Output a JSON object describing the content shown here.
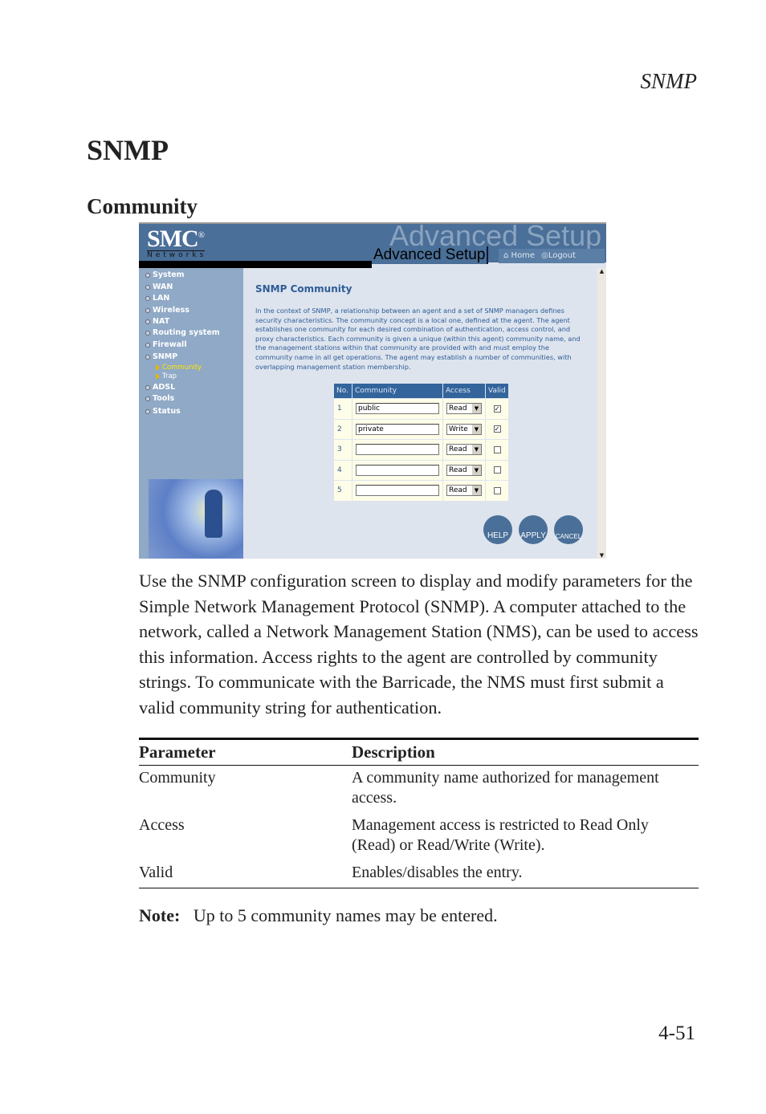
{
  "running_head": "SNMP",
  "heading": "SNMP",
  "subheading": "Community",
  "screenshot": {
    "logo": "SMC",
    "logo_sub": "Networks",
    "banner_ghost": "Advanced Setup",
    "banner": "Advanced Setup",
    "home": "Home",
    "logout": "Logout",
    "nav": [
      "System",
      "WAN",
      "LAN",
      "Wireless",
      "NAT",
      "Routing system",
      "Firewall",
      "SNMP",
      "ADSL",
      "Tools",
      "Status"
    ],
    "subnav": [
      "Community",
      "Trap"
    ],
    "title": "SNMP Community",
    "description": "In the context of SNMP, a relationship between an agent and a set of SNMP managers defines security characteristics. The community concept is a local one, defined at the agent. The agent establishes one community for each desired combination of authentication, access control, and proxy characteristics. Each community is given a unique (within this agent) community name, and the management stations within that community are provided with and must employ the community name in all get operations. The agent may establish a number of communities, with overlapping management station membership.",
    "table_headers": [
      "No.",
      "Community",
      "Access",
      "Valid"
    ],
    "rows": [
      {
        "no": "1",
        "community": "public",
        "access": "Read",
        "valid": true
      },
      {
        "no": "2",
        "community": "private",
        "access": "Write",
        "valid": true
      },
      {
        "no": "3",
        "community": "",
        "access": "Read",
        "valid": false
      },
      {
        "no": "4",
        "community": "",
        "access": "Read",
        "valid": false
      },
      {
        "no": "5",
        "community": "",
        "access": "Read",
        "valid": false
      }
    ],
    "buttons": [
      "HELP",
      "APPLY",
      "CANCEL"
    ]
  },
  "paragraph": "Use the SNMP configuration screen to display and modify parameters for the Simple Network Management Protocol (SNMP). A computer attached to the network, called a Network Management Station (NMS), can be used to access this information. Access rights to the agent are controlled by community strings. To communicate with the Barricade, the NMS must first submit a valid community string for authentication.",
  "param_table": {
    "headers": [
      "Parameter",
      "Description"
    ],
    "rows": [
      [
        "Community",
        "A community name authorized for management access."
      ],
      [
        "Access",
        "Management access is restricted to Read Only (Read) or Read/Write (Write)."
      ],
      [
        "Valid",
        "Enables/disables the entry."
      ]
    ]
  },
  "note_label": "Note:",
  "note_text": "Up to 5 community names may be entered.",
  "page_number": "4-51"
}
